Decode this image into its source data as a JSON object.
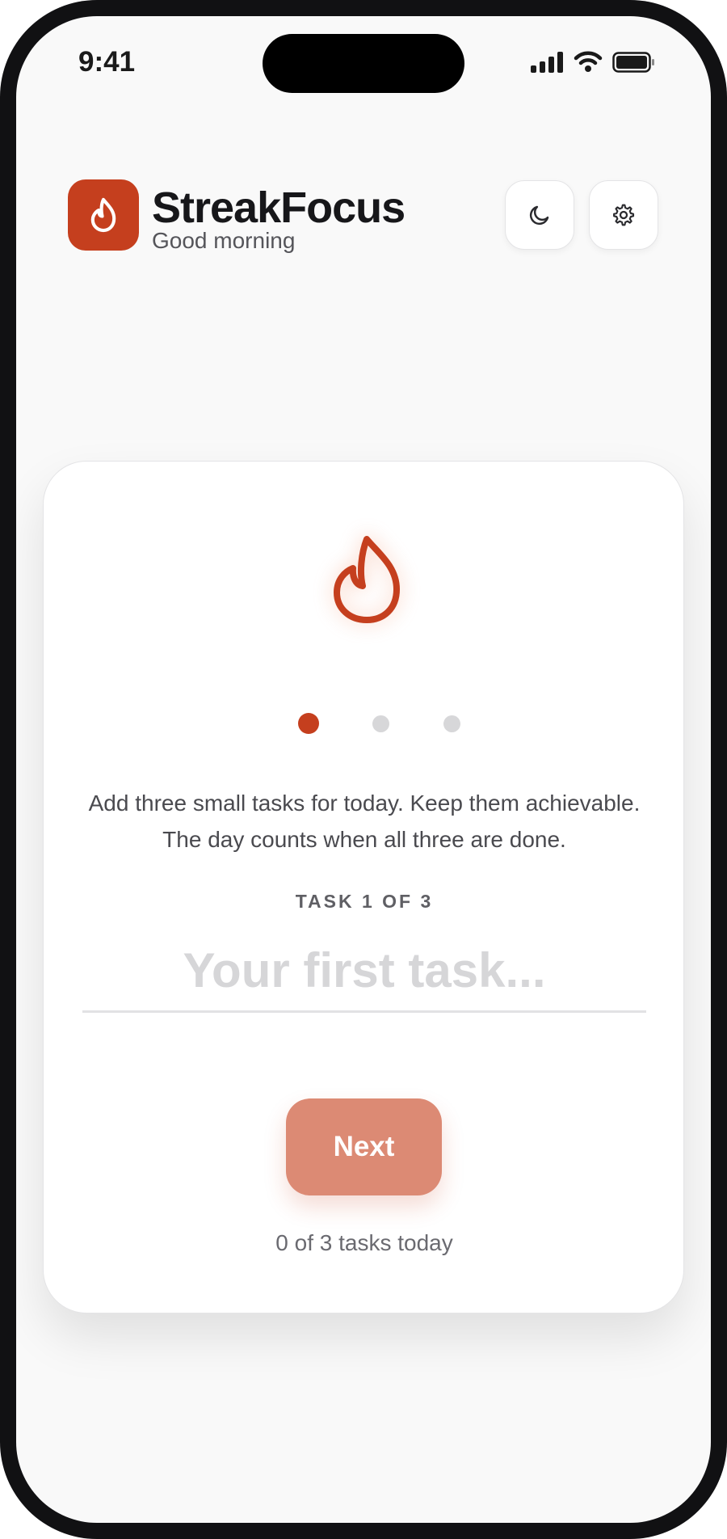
{
  "status_bar": {
    "time": "9:41",
    "icons": [
      "signal-icon",
      "wifi-icon",
      "battery-icon"
    ]
  },
  "header": {
    "logo_icon": "flame-icon",
    "title": "StreakFocus",
    "subtitle": "Good morning",
    "actions": [
      {
        "name": "dark-mode-button",
        "icon": "moon-icon"
      },
      {
        "name": "settings-button",
        "icon": "gear-icon"
      }
    ]
  },
  "card": {
    "hero_icon": "flame-icon",
    "steps": {
      "total": 3,
      "active": 1
    },
    "instruction": "Add three small tasks for today. Keep them achievable. The day counts when all three are done.",
    "task_label": "TASK 1 OF 3",
    "task_input": {
      "value": "",
      "placeholder": "Your first task..."
    },
    "next_label": "Next",
    "progress": "0 of 3 tasks today"
  },
  "colors": {
    "accent": "#c53f1e",
    "accent_disabled": "#dc8a74",
    "background": "#f9f9f9",
    "card": "#ffffff"
  }
}
